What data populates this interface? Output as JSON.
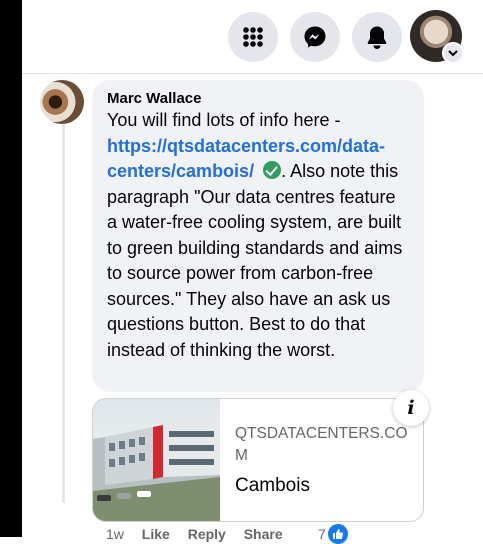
{
  "comment": {
    "author": "Marc Wallace",
    "text_before_link": "You will find lots of info here - ",
    "link_text": "https://qtsdatacenters.com/data-centers/cambois/",
    "text_after_check": ". Also note this paragraph \"Our data centres feature a water-free cooling system, are built to green building standards and aims to source power from carbon-free sources.\" They also have an ask us questions button. Best to do that instead of thinking the worst."
  },
  "link_preview": {
    "domain": "QTSDATACENTERS.COM",
    "title": "Cambois"
  },
  "actions": {
    "time": "1w",
    "like": "Like",
    "reply": "Reply",
    "share": "Share",
    "reaction_count": "7"
  },
  "icons": {
    "menu": "grid-menu-icon",
    "messenger": "messenger-icon",
    "notifications": "bell-icon",
    "info": "info-icon",
    "check": "check-mark-icon",
    "like": "thumbs-up-icon"
  },
  "colors": {
    "link": "#216fdb",
    "bubble": "#f0f2f5",
    "nav_button": "#e4e6eb",
    "check": "#2e9f5c",
    "like": "#1877f2"
  }
}
